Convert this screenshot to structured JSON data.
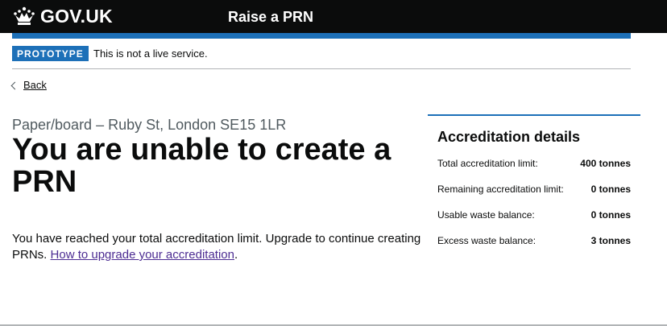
{
  "header": {
    "logo_text": "GOV.UK",
    "service_name": "Raise a PRN"
  },
  "phase_banner": {
    "tag": "PROTOTYPE",
    "text": "This is not a live service."
  },
  "back_link": "Back",
  "main": {
    "caption": "Paper/board – Ruby St, London SE15 1LR",
    "heading": "You are unable to create a PRN",
    "body_text": "You have reached your total accreditation limit. Upgrade to continue creating PRNs.",
    "link_text": "How to upgrade your accreditation",
    "after_link": "."
  },
  "aside": {
    "title": "Accreditation details",
    "rows": [
      {
        "label": "Total accreditation limit:",
        "value": "400 tonnes"
      },
      {
        "label": "Remaining accreditation limit:",
        "value": "0 tonnes"
      },
      {
        "label": "Usable waste balance:",
        "value": "0 tonnes"
      },
      {
        "label": "Excess waste balance:",
        "value": "3 tonnes"
      }
    ]
  },
  "colors": {
    "header_bg": "#0b0c0c",
    "brand_blue": "#1d70b8",
    "link": "#4c2c92",
    "secondary_text": "#505a5f"
  }
}
